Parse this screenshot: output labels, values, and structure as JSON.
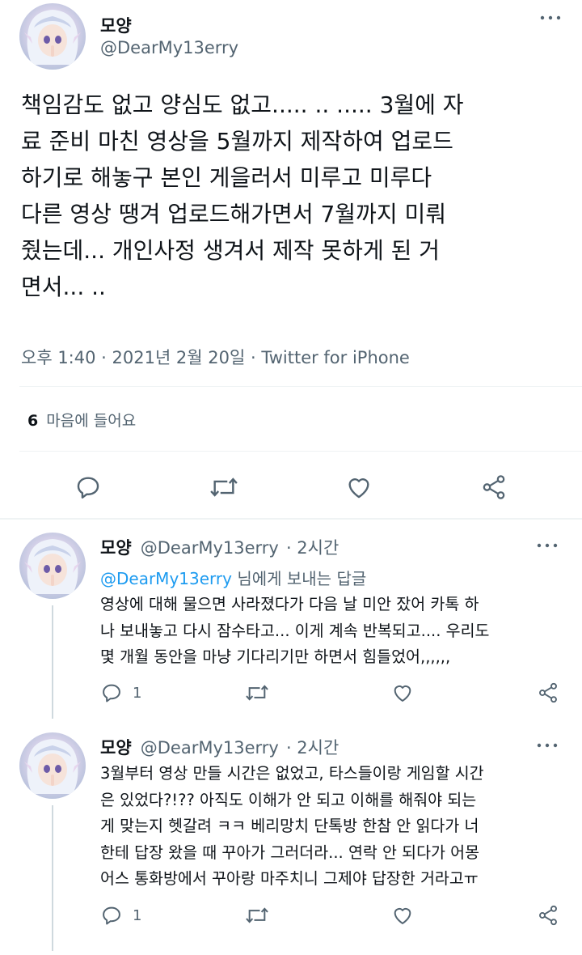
{
  "main_tweet": {
    "name": "모양",
    "handle": "@DearMy13erry",
    "text": "책임감도 없고 양심도 없고..... .. ..... 3월에 자\n료 준비 마친 영상을 5월까지 제작하여 업로드\n하기로 해놓구 본인 게을러서 미루고 미루다\n다른 영상 땡겨 업로드해가면서 7월까지 미뤄\n줬는데... 개인사정 생겨서 제작 못하게 된 거\n면서... ..",
    "timestamp": "오후 1:40 · 2021년 2월 20일 · Twitter for iPhone",
    "likes_count": "6",
    "likes_label": "마음에 들어요"
  },
  "replies": [
    {
      "name": "모양",
      "handle": "@DearMy13erry",
      "time": "· 2시간",
      "reply_to_mention": "@DearMy13erry",
      "reply_to_suffix": " 님에게 보내는 답글",
      "text": "영상에 대해 물으면 사라졌다가 다음 날 미안 잤어 카톡 하\n나 보내놓고 다시 잠수타고... 이게 계속 반복되고.... 우리도\n몇 개월 동안을 마냥 기다리기만 하면서 힘들었어,,,,,,",
      "reply_count": "1"
    },
    {
      "name": "모양",
      "handle": "@DearMy13erry",
      "time": "· 2시간",
      "text": "3월부터 영상 만들 시간은 없었고, 타스들이랑 게임할 시간\n은 있었다?!?? 아직도 이해가 안 되고 이해를 해줘야 되는\n게 맞는지 헷갈려 ㅋㅋ 베리망치 단톡방 한참 안 읽다가 너\n한테 답장 왔을 때 꾸아가 그러더라... 연락 안 되다가 어몽\n어스 통화방에서 꾸아랑 마주치니 그제야 답장한 거라고ㅠ",
      "reply_count": "1"
    }
  ],
  "icons": {
    "more": "more-horizontal-icon",
    "reply": "reply-icon",
    "retweet": "retweet-icon",
    "like": "heart-icon",
    "share": "share-icon"
  },
  "colors": {
    "text": "#0f1419",
    "secondary": "#536471",
    "mention": "#1d9bf0",
    "divider": "#eff3f4"
  }
}
